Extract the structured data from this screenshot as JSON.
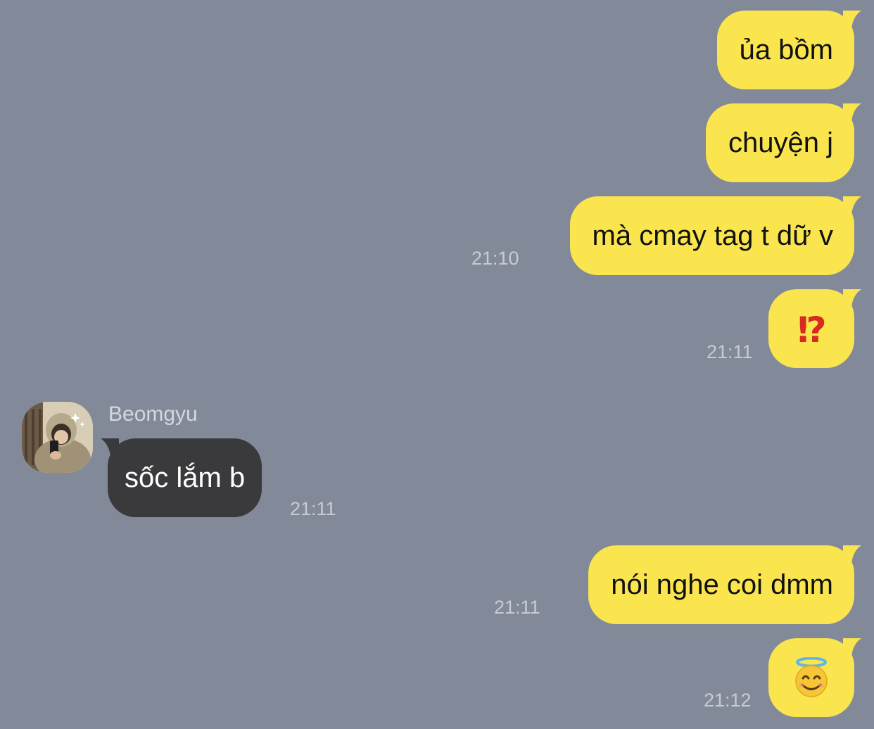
{
  "chat": {
    "messages": [
      {
        "direction": "outgoing",
        "text": "ủa bồm",
        "time": ""
      },
      {
        "direction": "outgoing",
        "text": "chuyện j",
        "time": ""
      },
      {
        "direction": "outgoing",
        "text": "mà cmay tag t dữ v",
        "time": "21:10"
      },
      {
        "direction": "outgoing",
        "text": "⁉",
        "time": "21:11",
        "icon": "interrobang-emoji-icon"
      },
      {
        "direction": "incoming",
        "sender": "Beomgyu",
        "text": "sốc lắm b",
        "time": "21:11"
      },
      {
        "direction": "outgoing",
        "text": "nói nghe coi dmm",
        "time": "21:11"
      },
      {
        "direction": "outgoing",
        "text": "",
        "time": "21:12",
        "icon": "smiling-face-with-halo-icon"
      }
    ]
  },
  "colors": {
    "background": "#828a9a",
    "outgoing_bubble": "#fae54e",
    "incoming_bubble": "#3a3a3c",
    "timestamp": "#c7cbd3"
  }
}
